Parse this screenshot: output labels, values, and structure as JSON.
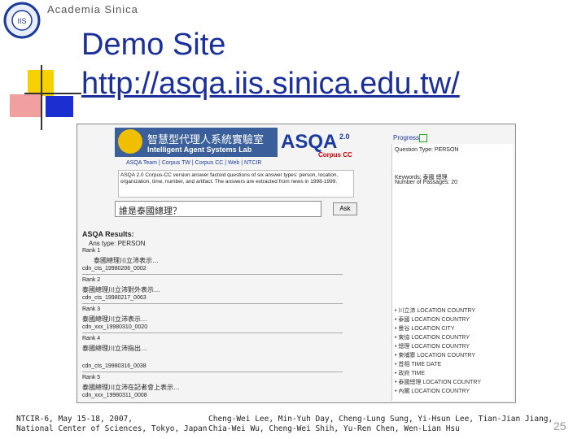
{
  "header": {
    "org": "Academia Sinica"
  },
  "slide": {
    "title": "Demo Site",
    "url": "http://asqa.iis.sinica.edu.tw/"
  },
  "screenshot": {
    "lab_name_cn": "智慧型代理人系統實驗室",
    "lab_name_en": "Intelligent Agent Systems Lab",
    "brand": "ASQA",
    "brand_version": "2.0",
    "corpus": "Corpus CC",
    "nav": "ASQA Team | Corpus TW | Corpus CC | Web | NTCIR",
    "intro": "ASQA 2.0 Corpus-CC version answer factoid questions of six answer types: person, location, organization, time, number, and artifact. The answers are extracted from news in 1998-1999.",
    "question": "誰是泰國總理？",
    "ask_button": "Ask",
    "results_label": "ASQA Results:",
    "answer_type": "Ans type: PERSON",
    "progress_label": "Progress",
    "answer_type_panel": "Question Type: PERSON",
    "keywords_label": "Keywords: 泰國 總理",
    "passages_label": "Number of Passages: 20",
    "results": [
      {
        "rank": "Rank 1",
        "text": "泰國總理川立沛表示…",
        "id": "cdn_cts_19980206_0002"
      },
      {
        "rank": "Rank 2",
        "text": "泰國總理川立沛對外表示…",
        "id": "cdn_cts_19980217_0063"
      },
      {
        "rank": "Rank 3",
        "text": "泰國總理川立沛表示…",
        "id": "cdn_xxx_19980310_0020"
      },
      {
        "rank": "Rank 4",
        "text": "泰國總理川立沛指出…",
        "id": "cdn_cts_19980316_0038"
      },
      {
        "rank": "Rank 5",
        "text": "泰國總理川立沛在記者會上表示…",
        "id": "cdn_xxx_19980311_0008"
      }
    ],
    "answer_list": [
      "川立沛 LOCATION COUNTRY",
      "泰國 LOCATION COUNTRY",
      "曼谷 LOCATION CITY",
      "東協 LOCATION COUNTRY",
      "總理 LOCATION COUNTRY",
      "柬埔寨 LOCATION COUNTRY",
      "首相 TIME DATE",
      "政府 TIME",
      "泰國總理 LOCATION COUNTRY",
      "內閣 LOCATION COUNTRY"
    ]
  },
  "footer": {
    "event_line1": "NTCIR-6, May 15-18, 2007,",
    "event_line2": "National Center of Sciences, Tokyo, Japan",
    "authors_line1": "Cheng-Wei Lee, Min-Yuh Day, Cheng-Lung Sung, Yi-Hsun Lee, Tian-Jian Jiang,",
    "authors_line2": "Chia-Wei Wu, Cheng-Wei Shih, Yu-Ren Chen, Wen-Lian Hsu",
    "page_number": "25"
  },
  "colors": {
    "title": "#1a2f9a",
    "accent_red": "#e8302a",
    "accent_yellow": "#f5d100",
    "accent_blue": "#1b2fd1"
  }
}
